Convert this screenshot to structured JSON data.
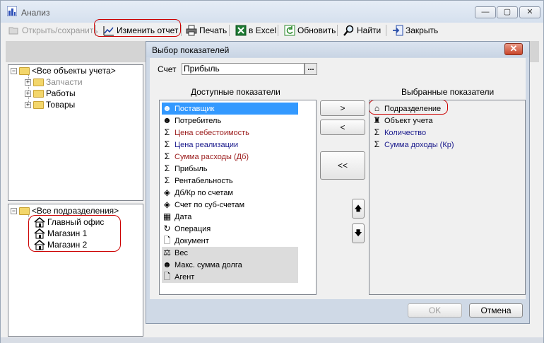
{
  "window": {
    "title": "Анализ",
    "minimize": "—",
    "maximize": "▢",
    "close": "✕"
  },
  "toolbar": {
    "open_save": "Открыть/сохранить",
    "edit_report": "Изменить отчет",
    "print": "Печать",
    "excel": "в Excel",
    "refresh": "Обновить",
    "find": "Найти",
    "close": "Закрыть"
  },
  "tree_objects": {
    "root": "<Все объекты учета>",
    "items": [
      "Запчасти",
      "Работы",
      "Товары"
    ]
  },
  "tree_departments": {
    "root": "<Все подразделения>",
    "items": [
      "Главный офис",
      "Магазин 1",
      "Магазин 2"
    ]
  },
  "dialog": {
    "title": "Выбор показателей",
    "close": "✕",
    "schet_label": "Счет",
    "schet_value": "Прибыль",
    "dots": "...",
    "available_title": "Доступные показатели",
    "selected_title": "Выбранные показатели",
    "available": [
      {
        "label": "Поставщик",
        "icon": "person-icon",
        "glyph": "☻",
        "style": "sel"
      },
      {
        "label": "Потребитель",
        "icon": "person-icon",
        "glyph": "☻",
        "style": ""
      },
      {
        "label": "Цена себестоимость",
        "icon": "sigma-icon",
        "glyph": "Σ",
        "style": "red"
      },
      {
        "label": "Цена реализации",
        "icon": "sigma-icon",
        "glyph": "Σ",
        "style": "blue"
      },
      {
        "label": "Сумма расходы (Дб)",
        "icon": "sigma-icon",
        "glyph": "Σ",
        "style": "red"
      },
      {
        "label": "Прибыль",
        "icon": "sigma-icon",
        "glyph": "Σ",
        "style": ""
      },
      {
        "label": "Рентабельность",
        "icon": "sigma-icon",
        "glyph": "Σ",
        "style": ""
      },
      {
        "label": "Дб/Кр по счетам",
        "icon": "account-icon",
        "glyph": "◈",
        "style": ""
      },
      {
        "label": "Счет по суб-счетам",
        "icon": "account-icon",
        "glyph": "◈",
        "style": ""
      },
      {
        "label": "Дата",
        "icon": "calendar-icon",
        "glyph": "▦",
        "style": ""
      },
      {
        "label": "Операция",
        "icon": "operation-icon",
        "glyph": "↻",
        "style": ""
      },
      {
        "label": "Документ",
        "icon": "document-icon",
        "glyph": "🗋",
        "style": ""
      },
      {
        "label": "Вес",
        "icon": "weight-icon",
        "glyph": "⚖",
        "style": "gray"
      },
      {
        "label": "Макс. сумма долга",
        "icon": "person-icon",
        "glyph": "☻",
        "style": "gray"
      },
      {
        "label": "Агент",
        "icon": "document-icon",
        "glyph": "🗋",
        "style": "gray"
      }
    ],
    "selected": [
      {
        "label": "Подразделение",
        "icon": "house-icon",
        "glyph": "⌂",
        "style": ""
      },
      {
        "label": "Объект учета",
        "icon": "object-icon",
        "glyph": "♜",
        "style": ""
      },
      {
        "label": "Количество",
        "icon": "sigma-icon",
        "glyph": "Σ",
        "style": "blue"
      },
      {
        "label": "Сумма доходы (Кр)",
        "icon": "sigma-icon",
        "glyph": "Σ",
        "style": "blue"
      }
    ],
    "btn_add": ">",
    "btn_remove": "<",
    "btn_remove_all": "<<",
    "btn_up": "🡅",
    "btn_down": "🡇",
    "ok": "OK",
    "cancel": "Отмена"
  }
}
